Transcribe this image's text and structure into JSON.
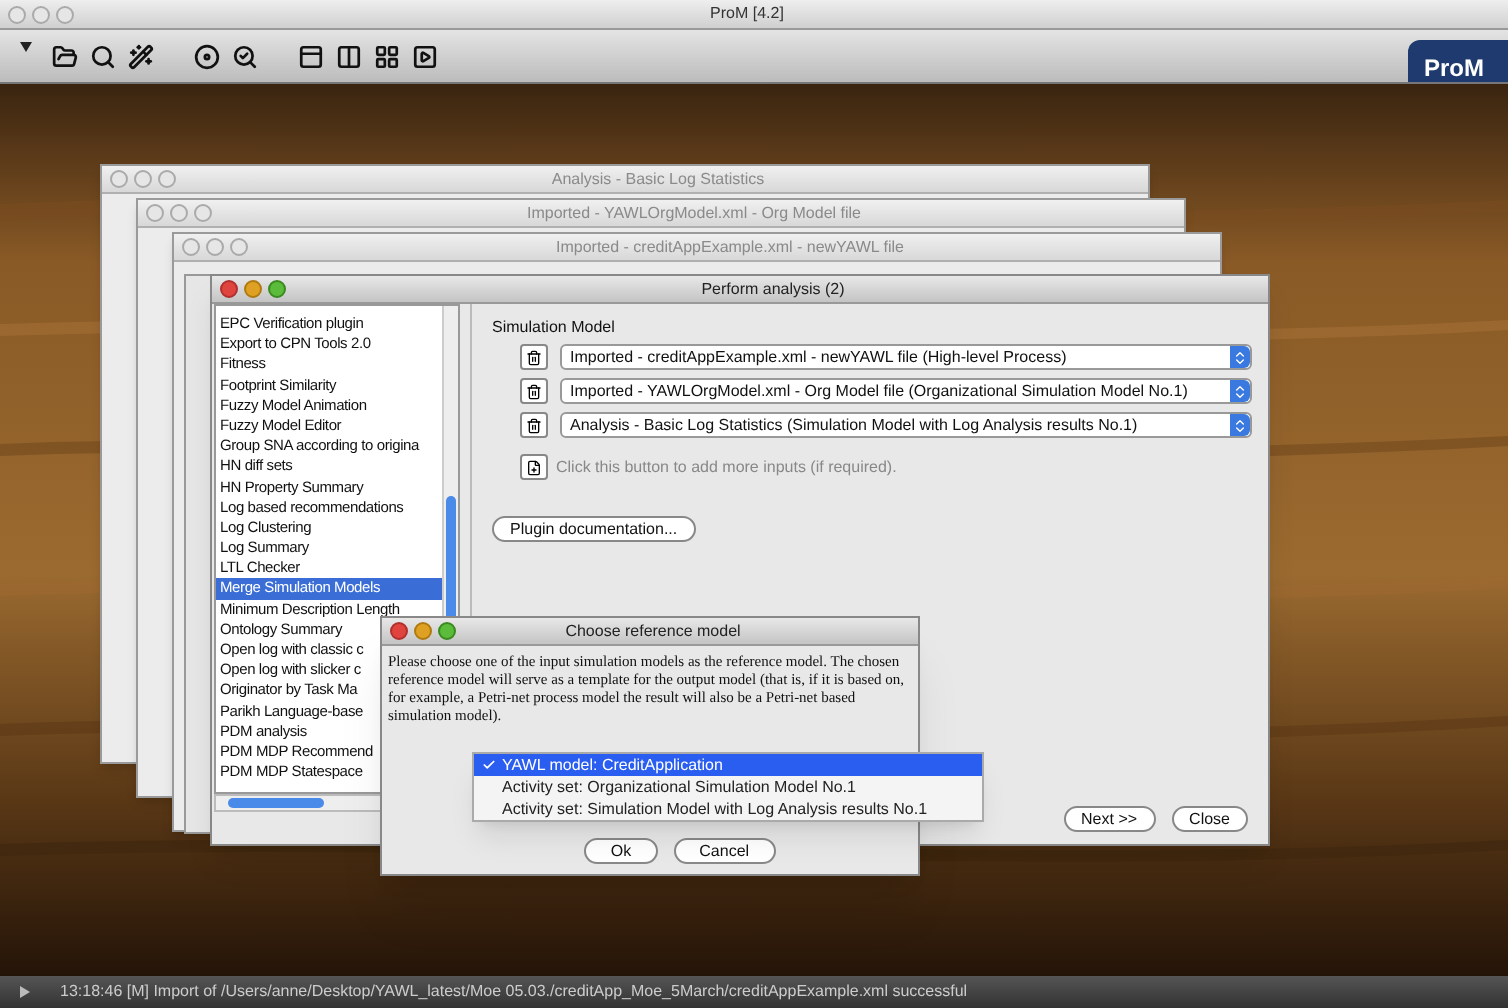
{
  "app": {
    "title": "ProM [4.2]",
    "logo": "ProM"
  },
  "background_windows": [
    {
      "title": "Analysis - Basic Log Statistics"
    },
    {
      "title": "Imported - YAWLOrgModel.xml - Org Model file"
    },
    {
      "title": "Imported - creditAppExample.xml - newYAWL file"
    }
  ],
  "analysis_window": {
    "title": "Perform analysis (2)",
    "plugins": [
      {
        "label": "EPC Verification plugin",
        "selected": false
      },
      {
        "label": "Export to CPN Tools 2.0",
        "selected": false
      },
      {
        "label": "Fitness",
        "selected": false
      },
      {
        "label": "Footprint Similarity",
        "selected": false
      },
      {
        "label": "Fuzzy Model Animation",
        "selected": false
      },
      {
        "label": "Fuzzy Model Editor",
        "selected": false
      },
      {
        "label": "Group SNA according to origina",
        "selected": false
      },
      {
        "label": "HN diff sets",
        "selected": false
      },
      {
        "label": "HN Property Summary",
        "selected": false
      },
      {
        "label": "Log based recommendations",
        "selected": false
      },
      {
        "label": "Log Clustering",
        "selected": false
      },
      {
        "label": "Log Summary",
        "selected": false
      },
      {
        "label": "LTL Checker",
        "selected": false
      },
      {
        "label": "Merge Simulation Models",
        "selected": true
      },
      {
        "label": "Minimum Description Length",
        "selected": false
      },
      {
        "label": "Ontology Summary",
        "selected": false
      },
      {
        "label": "Open log with classic c",
        "selected": false
      },
      {
        "label": "Open log with slicker c",
        "selected": false
      },
      {
        "label": "Originator by Task Ma",
        "selected": false
      },
      {
        "label": "Parikh Language-base",
        "selected": false
      },
      {
        "label": "PDM analysis",
        "selected": false
      },
      {
        "label": "PDM MDP Recommend",
        "selected": false
      },
      {
        "label": "PDM MDP Statespace",
        "selected": false
      }
    ],
    "section": "Simulation Model",
    "inputs": [
      "Imported - creditAppExample.xml - newYAWL file (High-level Process)",
      "Imported - YAWLOrgModel.xml - Org Model file (Organizational Simulation Model No.1)",
      "Analysis - Basic Log Statistics (Simulation Model with Log Analysis results No.1)"
    ],
    "add_hint": "Click this button to add more inputs (if required).",
    "doc_button": "Plugin documentation...",
    "buttons": [
      "Next >>",
      "Close"
    ]
  },
  "dialog": {
    "title": "Choose reference model",
    "message": "Please choose one of the input simulation models as the reference model. The chosen reference model will serve as a template for the output model (that is, if it is based on, for example, a Petri-net process model the result will also be a Petri-net based simulation model).",
    "options": [
      {
        "label": "YAWL model: CreditApplication",
        "selected": true
      },
      {
        "label": "Activity set: Organizational Simulation Model No.1",
        "selected": false
      },
      {
        "label": "Activity set: Simulation Model with Log Analysis results No.1",
        "selected": false
      }
    ],
    "buttons": [
      "Ok",
      "Cancel"
    ]
  },
  "status_bar": {
    "message": "13:18:46 [M] Import of /Users/anne/Desktop/YAWL_latest/Moe 05.03./creditApp_Moe_5March/creditAppExample.xml successful"
  }
}
